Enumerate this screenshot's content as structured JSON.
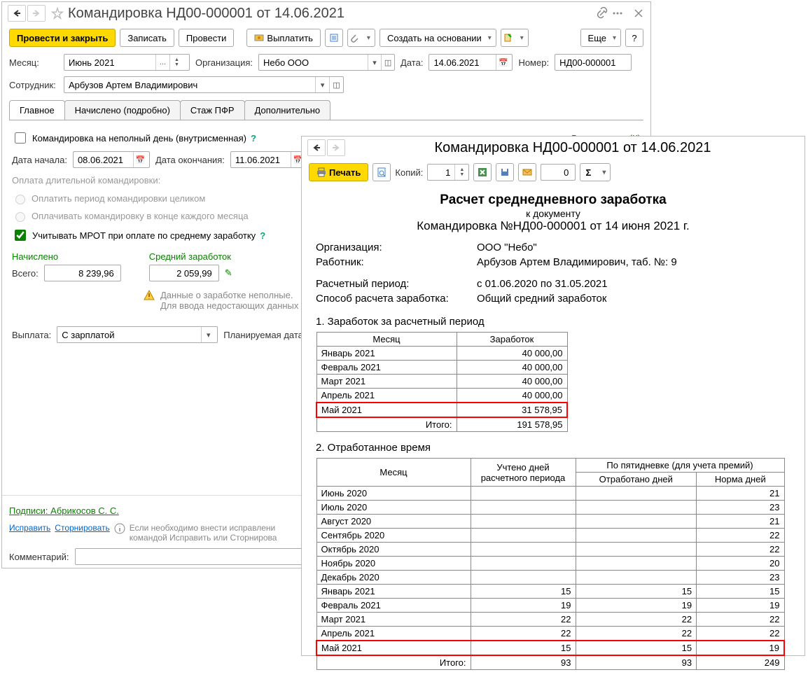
{
  "main_window": {
    "title": "Командировка НД00-000001 от 14.06.2021",
    "toolbar": {
      "submit_close": "Провести и закрыть",
      "save": "Записать",
      "submit": "Провести",
      "pay": "Выплатить",
      "create_based": "Создать на основании",
      "more": "Еще",
      "help": "?"
    },
    "fields": {
      "month_label": "Месяц:",
      "month_value": "Июнь 2021",
      "org_label": "Организация:",
      "org_value": "Небо ООО",
      "date_label": "Дата:",
      "date_value": "14.06.2021",
      "number_label": "Номер:",
      "number_value": "НД00-000001",
      "employee_label": "Сотрудник:",
      "employee_value": "Арбузов Артем Владимирович"
    },
    "tabs": {
      "main": "Главное",
      "accrued": "Начислено (подробно)",
      "pfr": "Стаж ПФР",
      "additional": "Дополнительно"
    },
    "tab_main": {
      "partial_day": "Командировка на неполный день (внутрисменная)",
      "time_type": "Вид времени (К)",
      "start_label": "Дата начала:",
      "start_value": "08.06.2021",
      "end_label": "Дата окончания:",
      "end_value": "11.06.2021",
      "long_trip_label": "Оплата длительной командировки:",
      "pay_whole": "Оплатить период командировки целиком",
      "pay_monthly": "Оплачивать командировку в конце каждого месяца",
      "use_mrot": "Учитывать МРОТ при оплате по среднему заработку",
      "accrued_label": "Начислено",
      "avg_label": "Средний заработок",
      "total_label": "Всего:",
      "total_value": "8 239,96",
      "avg_value": "2 059,99",
      "warning1": "Данные о заработке неполные.",
      "warning2": "Для ввода недостающих данных",
      "payment_label": "Выплата:",
      "payment_value": "С зарплатой",
      "planned_label": "Планируемая дата в"
    },
    "footer": {
      "signatures": "Подписи: Абрикосов С. С.",
      "correct": "Исправить",
      "reverse": "Сторнировать",
      "info": "Если необходимо внести исправлени\nкомандой Исправить или Сторнирова",
      "comment_label": "Комментарий:"
    }
  },
  "print_window": {
    "title": "Командировка НД00-000001 от 14.06.2021",
    "toolbar": {
      "print": "Печать",
      "copies_label": "Копий:",
      "copies_value": "1",
      "zero": "0"
    },
    "report": {
      "title": "Расчет среднедневного заработка",
      "sub": "к документу",
      "sub2": "Командировка №НД00-000001 от 14 июня 2021 г.",
      "org_label": "Организация:",
      "org_value": "ООО \"Небо\"",
      "emp_label": "Работник:",
      "emp_value": "Арбузов Артем Владимирович, таб. №: 9",
      "period_label": "Расчетный период:",
      "period_value": "с 01.06.2020 по 31.05.2021",
      "method_label": "Способ расчета заработка:",
      "method_value": "Общий средний заработок",
      "section1": "1. Заработок за расчетный период",
      "section2": "2. Отработанное время",
      "t1_h1": "Месяц",
      "t1_h2": "Заработок",
      "t1_rows": [
        {
          "m": "Январь 2021",
          "v": "40 000,00"
        },
        {
          "m": "Февраль 2021",
          "v": "40 000,00"
        },
        {
          "m": "Март 2021",
          "v": "40 000,00"
        },
        {
          "m": "Апрель 2021",
          "v": "40 000,00"
        },
        {
          "m": "Май 2021",
          "v": "31 578,95"
        }
      ],
      "t1_total_label": "Итого:",
      "t1_total_value": "191 578,95",
      "t2_h1": "Месяц",
      "t2_h2": "Учтено дней расчетного периода",
      "t2_h3": "По пятидневке (для учета премий)",
      "t2_h3a": "Отработано дней",
      "t2_h3b": "Норма дней",
      "t2_rows": [
        {
          "m": "Июнь 2020",
          "d": "",
          "w": "",
          "n": "21"
        },
        {
          "m": "Июль 2020",
          "d": "",
          "w": "",
          "n": "23"
        },
        {
          "m": "Август 2020",
          "d": "",
          "w": "",
          "n": "21"
        },
        {
          "m": "Сентябрь 2020",
          "d": "",
          "w": "",
          "n": "22"
        },
        {
          "m": "Октябрь 2020",
          "d": "",
          "w": "",
          "n": "22"
        },
        {
          "m": "Ноябрь 2020",
          "d": "",
          "w": "",
          "n": "20"
        },
        {
          "m": "Декабрь 2020",
          "d": "",
          "w": "",
          "n": "23"
        },
        {
          "m": "Январь 2021",
          "d": "15",
          "w": "15",
          "n": "15"
        },
        {
          "m": "Февраль 2021",
          "d": "19",
          "w": "19",
          "n": "19"
        },
        {
          "m": "Март 2021",
          "d": "22",
          "w": "22",
          "n": "22"
        },
        {
          "m": "Апрель 2021",
          "d": "22",
          "w": "22",
          "n": "22"
        },
        {
          "m": "Май 2021",
          "d": "15",
          "w": "15",
          "n": "19"
        }
      ],
      "t2_total_label": "Итого:",
      "t2_totals": {
        "d": "93",
        "w": "93",
        "n": "249"
      }
    }
  }
}
